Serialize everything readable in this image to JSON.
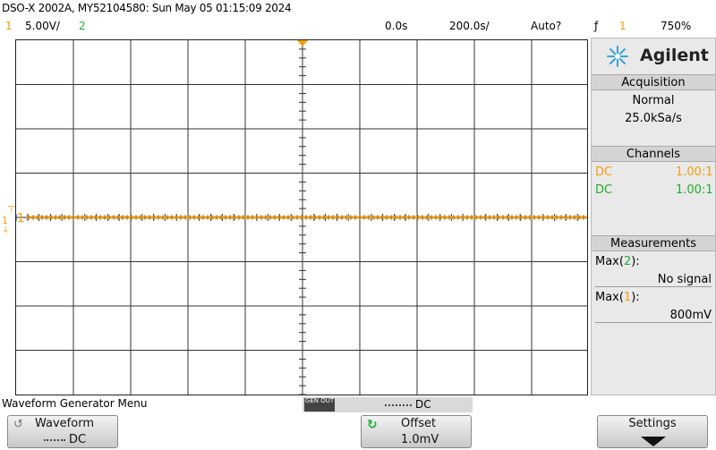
{
  "header": {
    "title": "DSO-X 2002A, MY52104580: Sun May 05 01:15:09 2024"
  },
  "status": {
    "ch1_num": "1",
    "ch1_scale": "5.00V/",
    "ch2_num": "2",
    "time_offset": "0.0s",
    "time_scale": "200.0s/",
    "trigger_mode": "Auto?",
    "trigger_icon": "ƒ",
    "trigger_src": "1",
    "trigger_level": "750%"
  },
  "sidebar": {
    "logo_text": "Agilent",
    "acquisition": {
      "title": "Acquisition",
      "mode": "Normal",
      "rate": "25.0kSa/s"
    },
    "channels": {
      "title": "Channels",
      "ch1_coupling": "DC",
      "ch1_probe": "1.00:1",
      "ch2_coupling": "DC",
      "ch2_probe": "1.00:1"
    },
    "measurements": {
      "title": "Measurements",
      "m1_prefix": "Max(",
      "m1_ch": "2",
      "m1_suffix": "):",
      "m1_value": "No signal",
      "m2_prefix": "Max(",
      "m2_ch": "1",
      "m2_suffix": "):",
      "m2_value": "800mV"
    }
  },
  "menu": {
    "title": "Waveform Generator Menu",
    "gen_out_label": "GEN OUT",
    "gen_out_mode": "DC"
  },
  "softkeys": {
    "waveform_label": "Waveform",
    "waveform_value": "DC",
    "offset_label": "Offset",
    "offset_value": "1.0mV",
    "settings_label": "Settings"
  },
  "display": {
    "ch1_marker": "1",
    "trace_level_fraction": 0.5
  },
  "colors": {
    "ch1": "#f39c11",
    "ch2": "#1fae2f"
  }
}
